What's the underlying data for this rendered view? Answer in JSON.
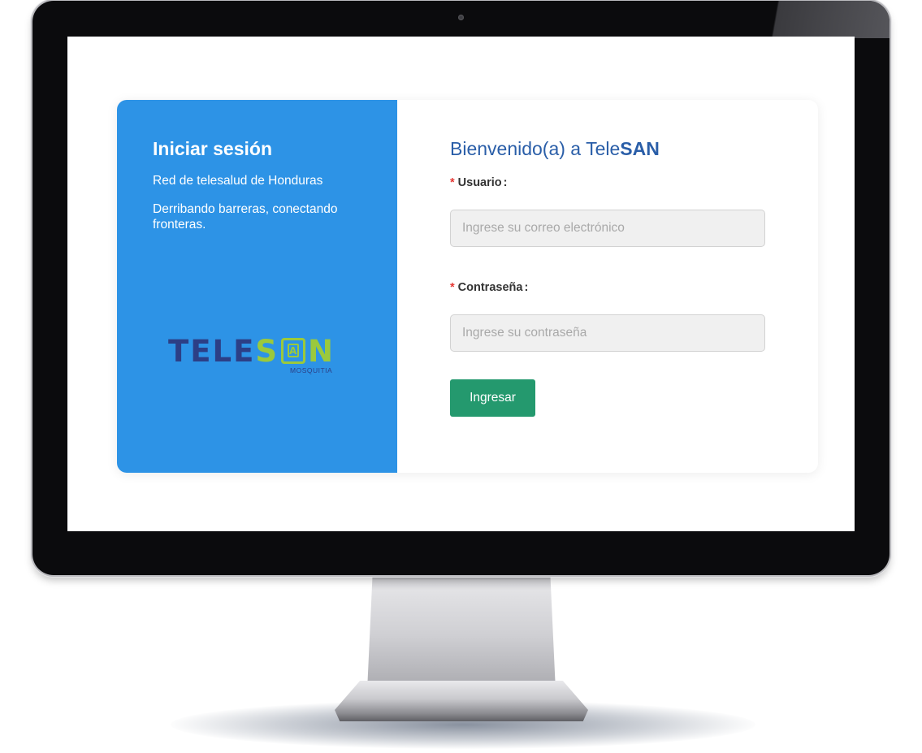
{
  "left_panel": {
    "title": "Iniciar sesión",
    "subtitle": "Red de telesalud de Honduras",
    "tagline": "Derribando barreras, conectando fronteras.",
    "logo": {
      "part1": "TELE",
      "part2": "S",
      "part3": "A",
      "part4": "N",
      "sub": "MOSQUITIA"
    }
  },
  "form": {
    "welcome_prefix": "Bienvenido(a) a Tele",
    "welcome_bold": "SAN",
    "user_label": "Usuario",
    "user_placeholder": "Ingrese su correo electrónico",
    "password_label": "Contraseña",
    "password_placeholder": "Ingrese su contraseña",
    "required_mark": "*",
    "colon": ":",
    "submit_label": "Ingresar"
  },
  "colors": {
    "left_panel_bg": "#2d93e6",
    "heading_blue": "#2a5ea8",
    "button_green": "#24996e",
    "required_red": "#e53935",
    "logo_navy": "#2c3f86",
    "logo_green": "#9bc93c"
  }
}
